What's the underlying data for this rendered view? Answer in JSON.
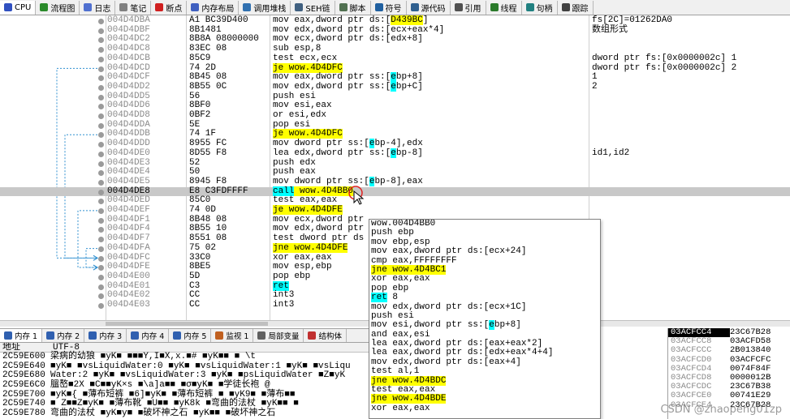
{
  "top_tabs": [
    {
      "label": "CPU",
      "color": "#3050c0"
    },
    {
      "label": "流程图",
      "color": "#2a8a2a"
    },
    {
      "label": "日志",
      "color": "#5070d0"
    },
    {
      "label": "笔记",
      "color": "#808080"
    },
    {
      "label": "断点",
      "color": "#d02020"
    },
    {
      "label": "内存布局",
      "color": "#4060c0"
    },
    {
      "label": "调用堆栈",
      "color": "#3070b0"
    },
    {
      "label": "SEH链",
      "color": "#406080"
    },
    {
      "label": "脚本",
      "color": "#507050"
    },
    {
      "label": "符号",
      "color": "#2060a0"
    },
    {
      "label": "源代码",
      "color": "#306090"
    },
    {
      "label": "引用",
      "color": "#505050"
    },
    {
      "label": "线程",
      "color": "#2a7a2a"
    },
    {
      "label": "句柄",
      "color": "#208080"
    },
    {
      "label": "跟踪",
      "color": "#404040"
    }
  ],
  "disasm": [
    {
      "addr": "004D4DBA",
      "bytes": "A1 BC39D400",
      "asm": [
        [
          "mov eax,dword ptr ds:[",
          ""
        ],
        [
          "D439BC",
          "y"
        ],
        [
          "]",
          ""
        ]
      ],
      "cmt": "fs[2C]=01262DA0"
    },
    {
      "addr": "004D4DBF",
      "bytes": "8B1481",
      "asm": [
        [
          "mov edx,dword ptr ds:[ecx+eax*4]",
          ""
        ]
      ],
      "cmt": "数组形式"
    },
    {
      "addr": "004D4DC2",
      "bytes": "8B8A 08000000",
      "asm": [
        [
          "mov ecx,dword ptr ds:[edx+8]",
          ""
        ]
      ],
      "cmt": ""
    },
    {
      "addr": "004D4DC8",
      "bytes": "83EC 08",
      "asm": [
        [
          "sub esp,8",
          ""
        ]
      ],
      "cmt": ""
    },
    {
      "addr": "004D4DCB",
      "bytes": "85C9",
      "asm": [
        [
          "test ecx,ecx",
          ""
        ]
      ],
      "cmt": "dword ptr fs:[0x0000002c] 1"
    },
    {
      "addr": "004D4DCD",
      "bytes": "74 2D",
      "asm": [
        [
          "je wow.4D4DFC",
          "y"
        ]
      ],
      "cmt": "dword ptr fs:[0x0000002c] 2"
    },
    {
      "addr": "004D4DCF",
      "bytes": "8B45 08",
      "asm": [
        [
          "mov eax,dword ptr ss:[",
          ""
        ],
        [
          "e",
          "c"
        ],
        [
          "bp+8]",
          ""
        ]
      ],
      "cmt": "1"
    },
    {
      "addr": "004D4DD2",
      "bytes": "8B55 0C",
      "asm": [
        [
          "mov edx,dword ptr ss:[",
          ""
        ],
        [
          "e",
          "c"
        ],
        [
          "bp+C]",
          ""
        ]
      ],
      "cmt": "2"
    },
    {
      "addr": "004D4DD5",
      "bytes": "56",
      "asm": [
        [
          "push esi",
          ""
        ]
      ],
      "cmt": ""
    },
    {
      "addr": "004D4DD6",
      "bytes": "8BF0",
      "asm": [
        [
          "mov esi,eax",
          ""
        ]
      ],
      "cmt": ""
    },
    {
      "addr": "004D4DD8",
      "bytes": "0BF2",
      "asm": [
        [
          "or esi,edx",
          ""
        ]
      ],
      "cmt": ""
    },
    {
      "addr": "004D4DDA",
      "bytes": "5E",
      "asm": [
        [
          "pop esi",
          ""
        ]
      ],
      "cmt": ""
    },
    {
      "addr": "004D4DDB",
      "bytes": "74 1F",
      "asm": [
        [
          "je wow.4D4DFC",
          "y"
        ]
      ],
      "cmt": ""
    },
    {
      "addr": "004D4DDD",
      "bytes": "8955 FC",
      "asm": [
        [
          "mov dword ptr ss:[",
          ""
        ],
        [
          "e",
          "c"
        ],
        [
          "bp-4],edx",
          ""
        ]
      ],
      "cmt": ""
    },
    {
      "addr": "004D4DE0",
      "bytes": "8D55 F8",
      "asm": [
        [
          "lea edx,dword ptr ss:[",
          ""
        ],
        [
          "e",
          "c"
        ],
        [
          "bp-8]",
          ""
        ]
      ],
      "cmt": "id1,id2"
    },
    {
      "addr": "004D4DE3",
      "bytes": "52",
      "asm": [
        [
          "push edx",
          ""
        ]
      ],
      "cmt": ""
    },
    {
      "addr": "004D4DE4",
      "bytes": "50",
      "asm": [
        [
          "push eax",
          ""
        ]
      ],
      "cmt": ""
    },
    {
      "addr": "004D4DE5",
      "bytes": "8945 F8",
      "asm": [
        [
          "mov dword ptr ss:[",
          ""
        ],
        [
          "e",
          "c"
        ],
        [
          "bp-8],eax",
          ""
        ]
      ],
      "cmt": ""
    },
    {
      "addr": "004D4DE8",
      "bytes": "E8 C3FDFFFF",
      "asm": [
        [
          "call",
          "c"
        ],
        [
          " wow.4D4BB0",
          "y"
        ]
      ],
      "cmt": "",
      "sel": true
    },
    {
      "addr": "004D4DED",
      "bytes": "85C0",
      "asm": [
        [
          "test eax,eax",
          ""
        ]
      ],
      "cmt": ""
    },
    {
      "addr": "004D4DEF",
      "bytes": "74 0D",
      "asm": [
        [
          "je wow.4D4DFE",
          "y"
        ]
      ],
      "cmt": ""
    },
    {
      "addr": "004D4DF1",
      "bytes": "8B48 08",
      "asm": [
        [
          "mov ecx,dword ptr",
          ""
        ]
      ],
      "cmt": ""
    },
    {
      "addr": "004D4DF4",
      "bytes": "8B55 10",
      "asm": [
        [
          "mov edx,dword ptr",
          ""
        ]
      ],
      "cmt": ""
    },
    {
      "addr": "004D4DF7",
      "bytes": "8551 08",
      "asm": [
        [
          "test dword ptr ds",
          ""
        ]
      ],
      "cmt": ""
    },
    {
      "addr": "004D4DFA",
      "bytes": "75 02",
      "asm": [
        [
          "jne wow.4D4DFE",
          "y"
        ]
      ],
      "cmt": ""
    },
    {
      "addr": "004D4DFC",
      "bytes": "33C0",
      "asm": [
        [
          "xor eax,eax",
          ""
        ]
      ],
      "cmt": ""
    },
    {
      "addr": "004D4DFE",
      "bytes": "8BE5",
      "asm": [
        [
          "mov esp,ebp",
          ""
        ]
      ],
      "cmt": ""
    },
    {
      "addr": "004D4E00",
      "bytes": "5D",
      "asm": [
        [
          "pop ebp",
          ""
        ]
      ],
      "cmt": ""
    },
    {
      "addr": "004D4E01",
      "bytes": "C3",
      "asm": [
        [
          "ret",
          "c"
        ]
      ],
      "cmt": ""
    },
    {
      "addr": "004D4E02",
      "bytes": "CC",
      "asm": [
        [
          "int3",
          ""
        ]
      ],
      "cmt": ""
    },
    {
      "addr": "004D4E03",
      "bytes": "CC",
      "asm": [
        [
          "int3",
          ""
        ]
      ],
      "cmt": ""
    }
  ],
  "popup": [
    [
      [
        "wow.004D4BB0",
        ""
      ]
    ],
    [
      [
        "push ebp",
        ""
      ]
    ],
    [
      [
        "mov ebp,esp",
        ""
      ]
    ],
    [
      [
        "mov eax,dword ptr ds:[ecx+24]",
        ""
      ]
    ],
    [
      [
        "cmp eax,FFFFFFFF",
        ""
      ]
    ],
    [
      [
        "jne wow.4D4BC1",
        "y"
      ]
    ],
    [
      [
        "xor eax,eax",
        ""
      ]
    ],
    [
      [
        "pop ebp",
        ""
      ]
    ],
    [
      [
        "ret",
        "c"
      ],
      [
        " 8",
        ""
      ]
    ],
    [
      [
        "mov edx,dword ptr ds:[ecx+1C]",
        ""
      ]
    ],
    [
      [
        "push esi",
        ""
      ]
    ],
    [
      [
        "mov esi,dword ptr ss:[",
        ""
      ],
      [
        "e",
        "c"
      ],
      [
        "bp+8]",
        ""
      ]
    ],
    [
      [
        "and eax,esi",
        ""
      ]
    ],
    [
      [
        "lea eax,dword ptr ds:[eax+eax*2]",
        ""
      ]
    ],
    [
      [
        "lea eax,dword ptr ds:[edx+eax*4+4]",
        ""
      ]
    ],
    [
      [
        "mov edx,dword ptr ds:[eax+4]",
        ""
      ]
    ],
    [
      [
        "test al,1",
        ""
      ]
    ],
    [
      [
        "jne wow.4D4BDC",
        "y"
      ]
    ],
    [
      [
        "test eax,eax",
        ""
      ]
    ],
    [
      [
        "jne wow.4D4BDE",
        "y"
      ]
    ],
    [
      [
        "xor eax,eax",
        ""
      ]
    ]
  ],
  "bottom_tabs": [
    {
      "label": "内存 1",
      "color": "#3060b0"
    },
    {
      "label": "内存 2",
      "color": "#3060b0"
    },
    {
      "label": "内存 3",
      "color": "#3060b0"
    },
    {
      "label": "内存 4",
      "color": "#3060b0"
    },
    {
      "label": "内存 5",
      "color": "#3060b0"
    },
    {
      "label": "监视 1",
      "color": "#c06020"
    },
    {
      "label": "局部变量",
      "color": "#606060"
    },
    {
      "label": "结构体",
      "color": "#c03030"
    }
  ],
  "dump": {
    "headers": [
      "地址",
      "UTF-8"
    ],
    "rows": [
      {
        "addr": "2C59E600",
        "text": "梁病的幼狼 ■yK■ ■■■Y,I■X,x.■#   ■yK■■ ■          \\t"
      },
      {
        "addr": "2C59E640",
        "text": "■yK■ ■vsLiquidWater:0 ■yK■ ■vsLiquidWater:1 ■yK■ ■vsLiqu"
      },
      {
        "addr": "2C59E680",
        "text": "Water:2 ■yK■ ■vsLiquidWater:3 ■yK■ ■psLiquidWater ■Z■yK"
      },
      {
        "addr": "2C59E6C0",
        "text": "膃嶅■2X ■C■■yK×s ■\\a]a■■ ■σ■yK■ ■学徒长袍  @"
      },
      {
        "addr": "2C59E700",
        "text": "■yK■{ ■薄布短裤 ■6]■yK■ ■薄布短裤 ■  ■yK9■ ■薄布■■"
      },
      {
        "addr": "2C59E740",
        "text": "■   Z■■Z■yK■ ■薄布靴 ■U■■  ■yK8k ■弯曲的法杖 ■yK■■ ■"
      },
      {
        "addr": "2C59E780",
        "text": "弯曲的法杖 ■yK■y■ ■破坏神之石 ■yK■■ ■破坏神之石"
      }
    ]
  },
  "stack": [
    {
      "addr": "03ACFCC4",
      "val": "23C67B28"
    },
    {
      "addr": "03ACFCC8",
      "val": "03ACFD58"
    },
    {
      "addr": "03ACFCCC",
      "val": "2B013840"
    },
    {
      "addr": "03ACFCD0",
      "val": "03ACFCFC"
    },
    {
      "addr": "03ACFCD4",
      "val": "0074F84F"
    },
    {
      "addr": "03ACFCD8",
      "val": "0000012B"
    },
    {
      "addr": "03ACFCDC",
      "val": "23C67B38"
    },
    {
      "addr": "03ACFCE0",
      "val": "00741E29"
    },
    {
      "addr": "03ACFCE4",
      "val": "23C67B28"
    }
  ],
  "watermark": "CSDN @zhaopeng01zp"
}
